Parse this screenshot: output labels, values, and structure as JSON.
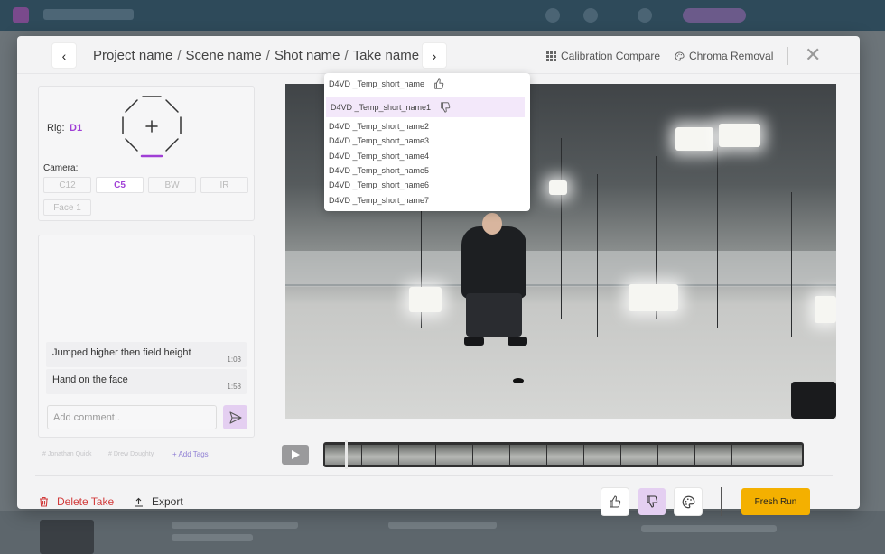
{
  "breadcrumb": {
    "project": "Project name",
    "scene": "Scene name",
    "shot": "Shot name",
    "take": "Take name",
    "separator": "/"
  },
  "header_actions": {
    "calibration": "Calibration Compare",
    "chroma": "Chroma Removal"
  },
  "rig": {
    "label": "Rig:",
    "value": "D1"
  },
  "camera": {
    "label": "Camera:",
    "buttons": [
      "C12",
      "C5",
      "BW",
      "IR",
      "Face 1"
    ],
    "active": "C5"
  },
  "comments": [
    {
      "text": "Jumped higher then field height",
      "time": "1:03"
    },
    {
      "text": "Hand on the face",
      "time": "1:58"
    }
  ],
  "comment_input": {
    "placeholder": "Add comment.."
  },
  "tags": {
    "items": [
      "# Jonathan Quick",
      "# Drew Doughty"
    ],
    "add_label": "+ Add Tags"
  },
  "take_dropdown": {
    "items": [
      {
        "label": "D4VD _Temp_short_name",
        "icon": "thumbs-up-icon"
      },
      {
        "label": "D4VD _Temp_short_name1",
        "icon": "thumbs-down-icon",
        "selected": true
      },
      {
        "label": "D4VD _Temp_short_name2"
      },
      {
        "label": "D4VD _Temp_short_name3"
      },
      {
        "label": "D4VD _Temp_short_name4"
      },
      {
        "label": "D4VD _Temp_short_name5"
      },
      {
        "label": "D4VD _Temp_short_name6"
      },
      {
        "label": "D4VD _Temp_short_name7"
      }
    ]
  },
  "footer": {
    "delete_label": "Delete Take",
    "export_label": "Export",
    "fresh_run_label": "Fresh Run"
  },
  "colors": {
    "accent": "#a03fd6",
    "accent_light": "#e4cff1",
    "danger": "#d23b3b",
    "primary_button": "#f4b000"
  }
}
